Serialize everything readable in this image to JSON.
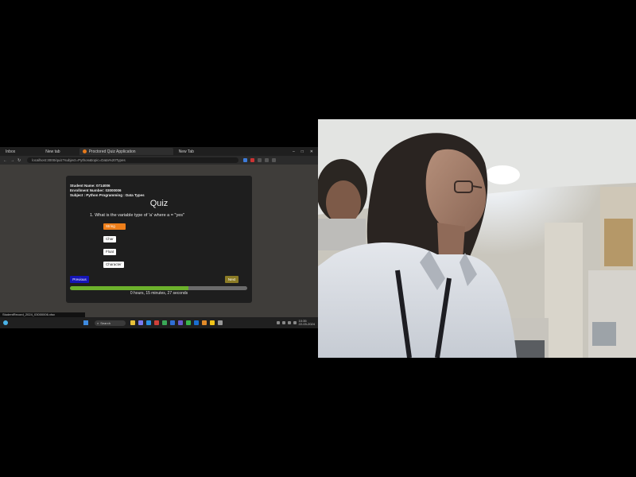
{
  "browser": {
    "tabs": [
      {
        "label": "Inbox"
      },
      {
        "label": "New tab"
      },
      {
        "label": "Proctored Quiz Application",
        "active": true
      },
      {
        "label": "New Tab"
      }
    ],
    "url": "localhost:3000/quiz?subject=Python&topic=Data%20Types",
    "window_controls": [
      "–",
      "□",
      "✕"
    ]
  },
  "quiz": {
    "student_name": "Student Name: 0714006",
    "enrollment_number": "Enrollment Number: 03000006",
    "subject": "Subject : Python Programming : Data Types",
    "title": "Quiz",
    "question": "1. What is the variable type of 'a' where a = \"yes\"",
    "options": [
      "String",
      "Char",
      "Float",
      "Character"
    ],
    "selected_option_index": 0,
    "previous_label": "Previous",
    "next_label": "Next",
    "progress_fraction": 0.67,
    "timer": "0 hours, 15 minutes, 27 seconds",
    "accent_colors": {
      "selected": "#ef7f1a",
      "previous": "#1515b8",
      "next": "#8b7b25",
      "progress": "#6cb12c"
    }
  },
  "taskbar": {
    "download_text": "StudentRecord_2024_03000006.xlsx",
    "search_placeholder": "Search",
    "time": "10:35",
    "date": "22-03-2024"
  },
  "webcam": {
    "description_icon": "webcam-feed"
  }
}
